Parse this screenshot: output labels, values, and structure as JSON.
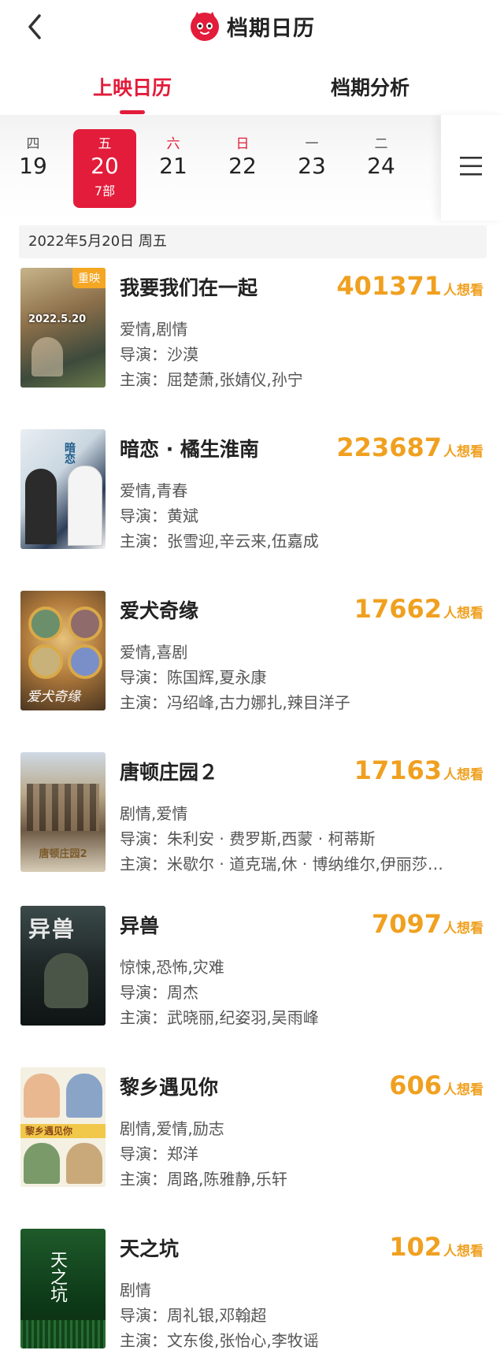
{
  "header": {
    "title": "档期日历"
  },
  "tabs": [
    {
      "label": "上映日历",
      "active": true
    },
    {
      "label": "档期分析",
      "active": false
    }
  ],
  "calendar": {
    "days": [
      {
        "weekday": "四",
        "date": "19",
        "count": ""
      },
      {
        "weekday": "五",
        "date": "20",
        "count": "7部",
        "selected": true
      },
      {
        "weekday": "六",
        "date": "21",
        "count": ""
      },
      {
        "weekday": "日",
        "date": "22",
        "count": ""
      },
      {
        "weekday": "一",
        "date": "23",
        "count": ""
      },
      {
        "weekday": "二",
        "date": "24",
        "count": ""
      }
    ]
  },
  "current_date": "2022年5月20日  周五",
  "want_suffix": "人想看",
  "labels": {
    "director": "导演：",
    "cast": "主演："
  },
  "movies": [
    {
      "title": "我要我们在一起",
      "badge": "重映",
      "want": "401371",
      "genres": "爱情,剧情",
      "director": "沙漠",
      "cast": "屈楚萧,张婧仪,孙宁",
      "poster_text": "2022.5.20"
    },
    {
      "title": "暗恋 · 橘生淮南",
      "want": "223687",
      "genres": "爱情,青春",
      "director": "黄斌",
      "cast": "张雪迎,辛云来,伍嘉成",
      "poster_text": "暗恋"
    },
    {
      "title": "爱犬奇缘",
      "want": "17662",
      "genres": "爱情,喜剧",
      "director": "陈国辉,夏永康",
      "cast": "冯绍峰,古力娜扎,辣目洋子",
      "poster_text": "爱犬奇缘"
    },
    {
      "title": "唐顿庄园２",
      "want": "17163",
      "genres": "剧情,爱情",
      "director": "朱利安 · 费罗斯,西蒙 · 柯蒂斯",
      "cast": "米歇尔 · 道克瑞,休 · 博纳维尔,伊丽莎…",
      "poster_text": "唐顿庄园2"
    },
    {
      "title": "异兽",
      "want": "7097",
      "genres": "惊悚,恐怖,灾难",
      "director": "周杰",
      "cast": "武晓丽,纪姿羽,吴雨峰",
      "poster_text": "异兽"
    },
    {
      "title": "黎乡遇见你",
      "want": "606",
      "genres": "剧情,爱情,励志",
      "director": "郑洋",
      "cast": "周路,陈雅静,乐轩",
      "poster_text": "黎乡遇见你"
    },
    {
      "title": "天之坑",
      "want": "102",
      "genres": "剧情",
      "director": "周礼银,邓翰超",
      "cast": "文东俊,张怡心,李牧谣",
      "poster_text": "天之坑"
    }
  ],
  "colors": {
    "accent": "#e21c3a",
    "want": "#f0a020",
    "badge": "#f5a623"
  }
}
